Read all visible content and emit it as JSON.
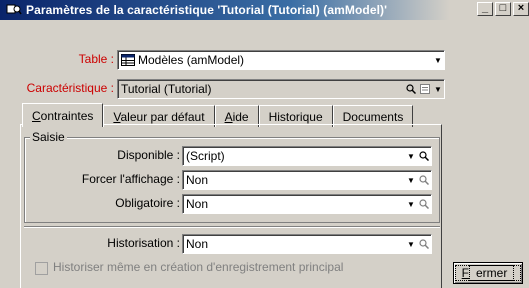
{
  "window": {
    "title": "Paramètres de la caractéristique 'Tutorial (Tutorial) (amModel)'",
    "minimize_glyph": "_",
    "maximize_glyph": "□",
    "close_glyph": "×"
  },
  "fields": {
    "table_label": "Table :",
    "table_value": "Modèles (amModel)",
    "caracteristique_label": "Caractéristique :",
    "caracteristique_value": "Tutorial (Tutorial)"
  },
  "tabs": [
    {
      "label": "Contraintes",
      "accel": "C",
      "rest": "ontraintes",
      "active": true
    },
    {
      "label": "Valeur par défaut",
      "accel": "V",
      "rest": "aleur par défaut",
      "active": false
    },
    {
      "label": "Aide",
      "accel": "A",
      "rest": "ide",
      "active": false
    },
    {
      "label": "Historique",
      "accel": "",
      "rest": "Historique",
      "active": false
    },
    {
      "label": "Documents",
      "accel": "",
      "rest": "Documents",
      "active": false
    }
  ],
  "saisie": {
    "group_title": "Saisie",
    "disponible_label": "Disponible :",
    "disponible_value": "(Script)",
    "forcer_label": "Forcer l'affichage :",
    "forcer_value": "Non",
    "obligatoire_label": "Obligatoire :",
    "obligatoire_value": "Non"
  },
  "historisation": {
    "label": "Historisation :",
    "value": "Non"
  },
  "checkbox": {
    "label": "Historiser même en création d'enregistrement principal",
    "checked": false
  },
  "buttons": {
    "close_label": "Fermer",
    "close_accel": "F",
    "close_rest": "ermer"
  },
  "colors": {
    "title_start": "#0a246a",
    "title_end": "#3a6ea5",
    "label_red": "#cc0000",
    "background": "#d4d0c8",
    "disabled_text": "#808080"
  }
}
